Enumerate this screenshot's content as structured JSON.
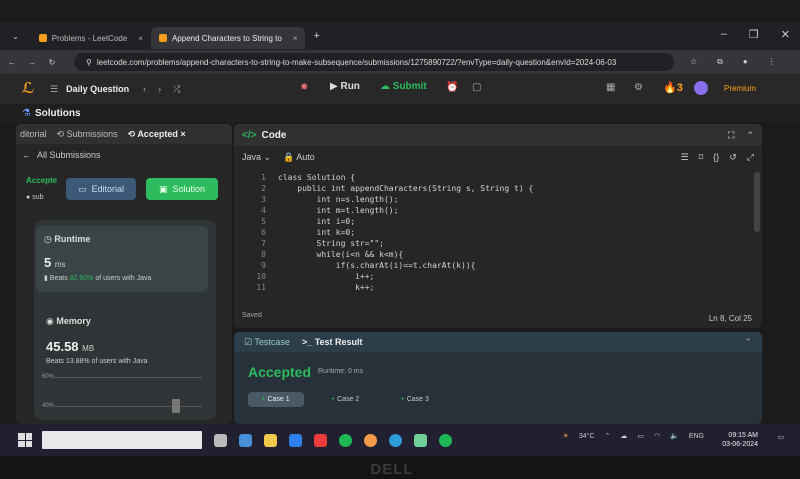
{
  "browser": {
    "tabs": [
      {
        "label": "Problems - LeetCode"
      },
      {
        "label": "Append Characters to String to"
      }
    ],
    "url": "leetcode.com/problems/append-characters-to-string-to-make-subsequence/submissions/1275890722/?envType=daily-question&envId=2024-06-03"
  },
  "header": {
    "daily_question": "Daily Question",
    "run": "Run",
    "submit": "Submit",
    "streak": "3",
    "premium": "Premium"
  },
  "solutions_bar": "Solutions",
  "left": {
    "tabs": [
      "ditorial",
      "Submissions",
      "Accepted"
    ],
    "all_submissions": "All Submissions",
    "accepted_short": "Accepte",
    "user_short": "sub",
    "editorial_btn": "Editorial",
    "solution_btn": "Solution",
    "runtime_label": "Runtime",
    "runtime_value": "5",
    "runtime_unit": "ms",
    "runtime_beats_pct": "82.60%",
    "runtime_beats_text": "of users with Java",
    "memory_label": "Memory",
    "memory_value": "45.58",
    "memory_unit": "MB",
    "memory_beats": "Beats 13.88% of users with Java",
    "axis_top": "60%",
    "axis_bottom": "40%"
  },
  "code": {
    "title": "Code",
    "language": "Java",
    "mode": "Auto",
    "lines": [
      "class Solution {",
      "    public int appendCharacters(String s, String t) {",
      "        int n=s.length();",
      "        int m=t.length();",
      "        int i=0;",
      "        int k=0;",
      "        String str=\"\";",
      "        while(i<n && k<m){",
      "            if(s.charAt(i)==t.charAt(k)){",
      "                i++;",
      "                k++;"
    ],
    "saved": "Saved",
    "cursor": "Ln 8, Col 25"
  },
  "test": {
    "tab_testcase": "Testcase",
    "tab_result": "Test Result",
    "status": "Accepted",
    "runtime": "Runtime: 0 ms",
    "cases": [
      "Case 1",
      "Case 2",
      "Case 3"
    ]
  },
  "taskbar": {
    "temp": "34°C",
    "lang": "ENG",
    "time": "09:15 AM",
    "date": "03-06-2024"
  },
  "colors": {
    "accent": "#2cbb5d",
    "brand": "#ffa116"
  }
}
